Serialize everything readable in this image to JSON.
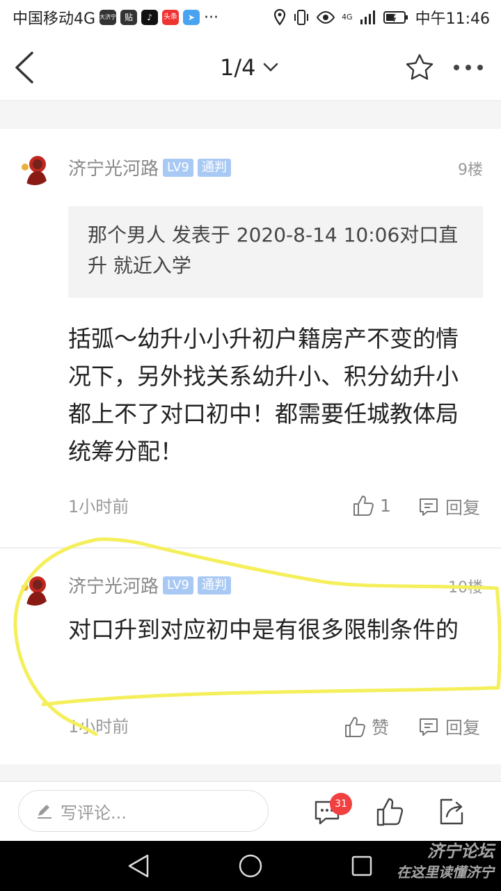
{
  "statusbar": {
    "carrier": "中国移动4G",
    "app_badge_1": "大济宁",
    "app_badge_2": "贴",
    "app_badge_3": "头条",
    "network": "4G",
    "time": "中午11:46"
  },
  "navbar": {
    "page_indicator": "1/4"
  },
  "posts": [
    {
      "username": "济宁光河路",
      "level": "LV9",
      "badge": "通判",
      "floor": "9楼",
      "quote": "那个男人 发表于 2020-8-14 10:06对口直升 就近入学",
      "content": "括弧～幼升小小升初户籍房产不变的情况下，另外找关系幼升小、积分幼升小都上不了对口初中！都需要任城教体局统筹分配！",
      "time": "1小时前",
      "like_label": "1",
      "reply_label": "回复"
    },
    {
      "username": "济宁光河路",
      "level": "LV9",
      "badge": "通判",
      "floor": "10楼",
      "content": "对口升到对应初中是有很多限制条件的",
      "time": "1小时前",
      "like_label": "赞",
      "reply_label": "回复"
    }
  ],
  "bottombar": {
    "comment_placeholder": "写评论...",
    "comment_count": "31"
  },
  "watermark": {
    "line1": "济宁论坛",
    "line2": "在这里读懂济宁"
  },
  "colors": {
    "tag_bg": "#a9c9f5",
    "badge_red": "#f04040",
    "annotation_yellow": "#f4ef5a"
  }
}
